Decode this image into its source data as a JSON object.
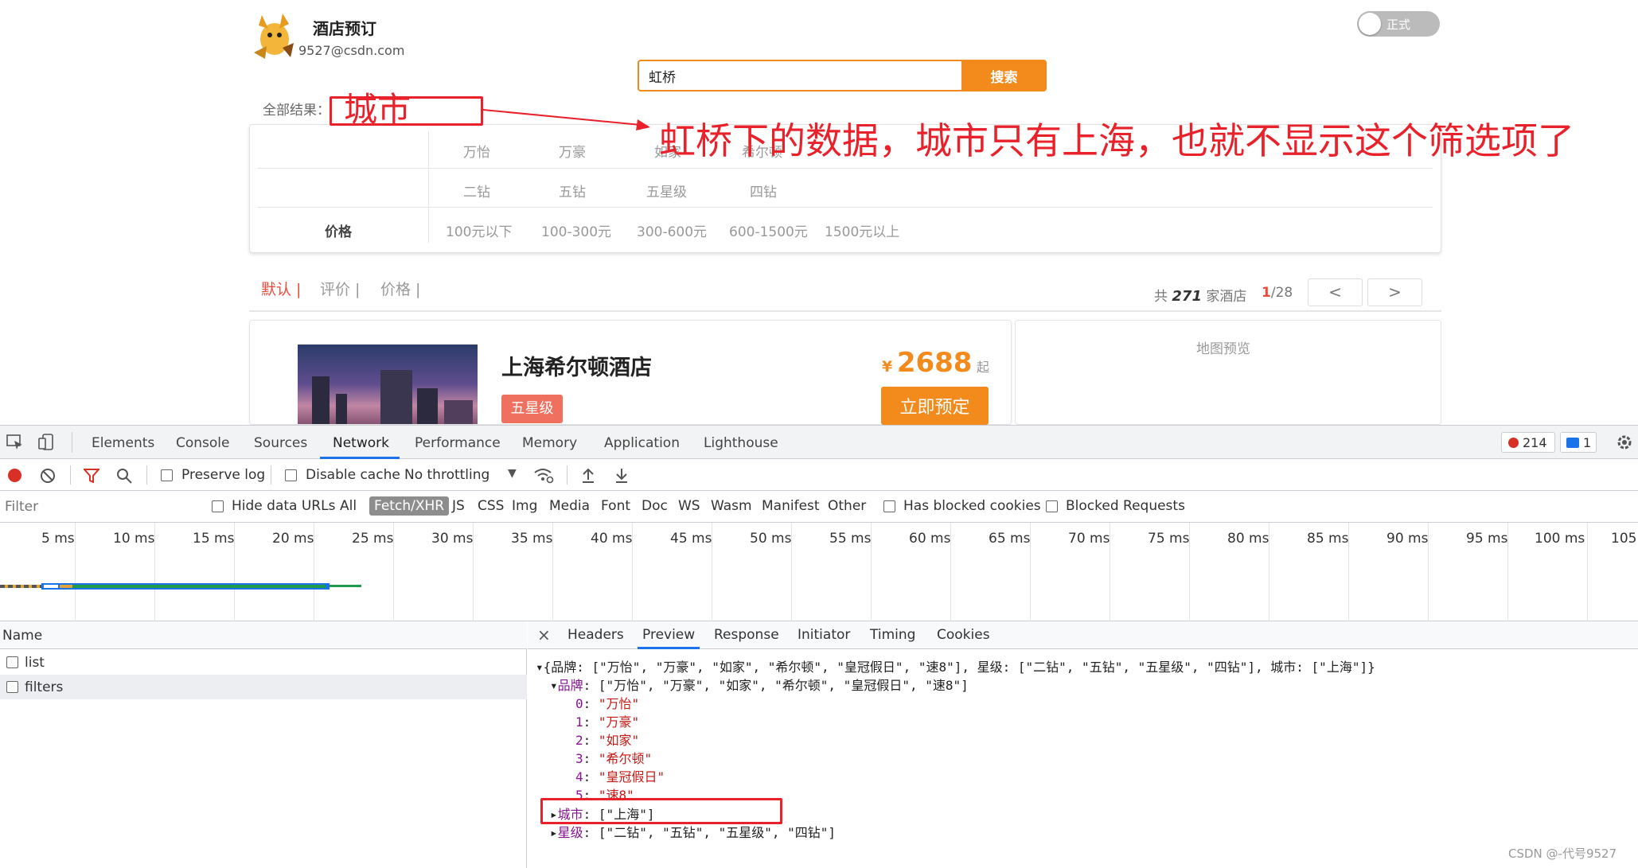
{
  "app": {
    "title": "酒店预订",
    "email": "9527@csdn.com",
    "toggle_label": "正式"
  },
  "search": {
    "value": "虹桥",
    "button": "搜索"
  },
  "filters": {
    "all_results": "全部结果：",
    "brands": [
      "万怡",
      "万豪",
      "如家",
      "希尔顿"
    ],
    "stars": [
      "二钻",
      "五钻",
      "五星级",
      "四钻"
    ],
    "price_label": "价格",
    "prices": [
      "100元以下",
      "100-300元",
      "300-600元",
      "600-1500元",
      "1500元以上"
    ]
  },
  "sort": {
    "default": "默认 |",
    "rating": "评价 |",
    "price": "价格 |"
  },
  "results": {
    "total_prefix": "共",
    "total": "271",
    "total_suffix": "家酒店",
    "page_current": "1",
    "page_total": "/28",
    "prev": "<",
    "next": ">"
  },
  "hotel": {
    "name": "上海希尔顿酒店",
    "star": "五星级",
    "currency": "¥",
    "price": "2688",
    "price_suffix": "起",
    "book": "立即预定"
  },
  "map": {
    "label": "地图预览"
  },
  "annotations": {
    "box_label": "城市",
    "callout": "虹桥下的数据，城市只有上海，也就不显示这个筛选项了"
  },
  "devtools": {
    "tabs": [
      "Elements",
      "Console",
      "Sources",
      "Network",
      "Performance",
      "Memory",
      "Application",
      "Lighthouse"
    ],
    "active_tab": "Network",
    "error_count": "214",
    "message_count": "1",
    "toolbar": {
      "preserve_log": "Preserve log",
      "disable_cache": "Disable cache",
      "throttling": "No throttling"
    },
    "filter": {
      "placeholder": "Filter",
      "hide_data_urls": "Hide data URLs",
      "types": [
        "All",
        "Fetch/XHR",
        "JS",
        "CSS",
        "Img",
        "Media",
        "Font",
        "Doc",
        "WS",
        "Wasm",
        "Manifest",
        "Other"
      ],
      "selected_type": "Fetch/XHR",
      "has_blocked_cookies": "Has blocked cookies",
      "blocked_requests": "Blocked Requests"
    },
    "timeline_ticks": [
      "5 ms",
      "10 ms",
      "15 ms",
      "20 ms",
      "25 ms",
      "30 ms",
      "35 ms",
      "40 ms",
      "45 ms",
      "50 ms",
      "55 ms",
      "60 ms",
      "65 ms",
      "70 ms",
      "75 ms",
      "80 ms",
      "85 ms",
      "90 ms",
      "95 ms",
      "100 ms",
      "105"
    ],
    "name_header": "Name",
    "requests": [
      "list",
      "filters"
    ],
    "selected_request": "filters",
    "detail_tabs": [
      "Headers",
      "Preview",
      "Response",
      "Initiator",
      "Timing",
      "Cookies"
    ],
    "active_detail_tab": "Preview",
    "preview": {
      "summary": "{品牌: [\"万怡\", \"万豪\", \"如家\", \"希尔顿\", \"皇冠假日\", \"速8\"], 星级: [\"二钻\", \"五钻\", \"五星级\", \"四钻\"], 城市: [\"上海\"]}",
      "brand_key": "品牌",
      "brand_line": "[\"万怡\", \"万豪\", \"如家\", \"希尔顿\", \"皇冠假日\", \"速8\"]",
      "brand_items": [
        "\"万怡\"",
        "\"万豪\"",
        "\"如家\"",
        "\"希尔顿\"",
        "\"皇冠假日\"",
        "\"速8\""
      ],
      "city_key": "城市",
      "city_line": "[\"上海\"]",
      "star_key": "星级",
      "star_line": "[\"二钻\", \"五钻\", \"五星级\", \"四钻\"]"
    }
  },
  "watermark": "CSDN @-代号9527"
}
